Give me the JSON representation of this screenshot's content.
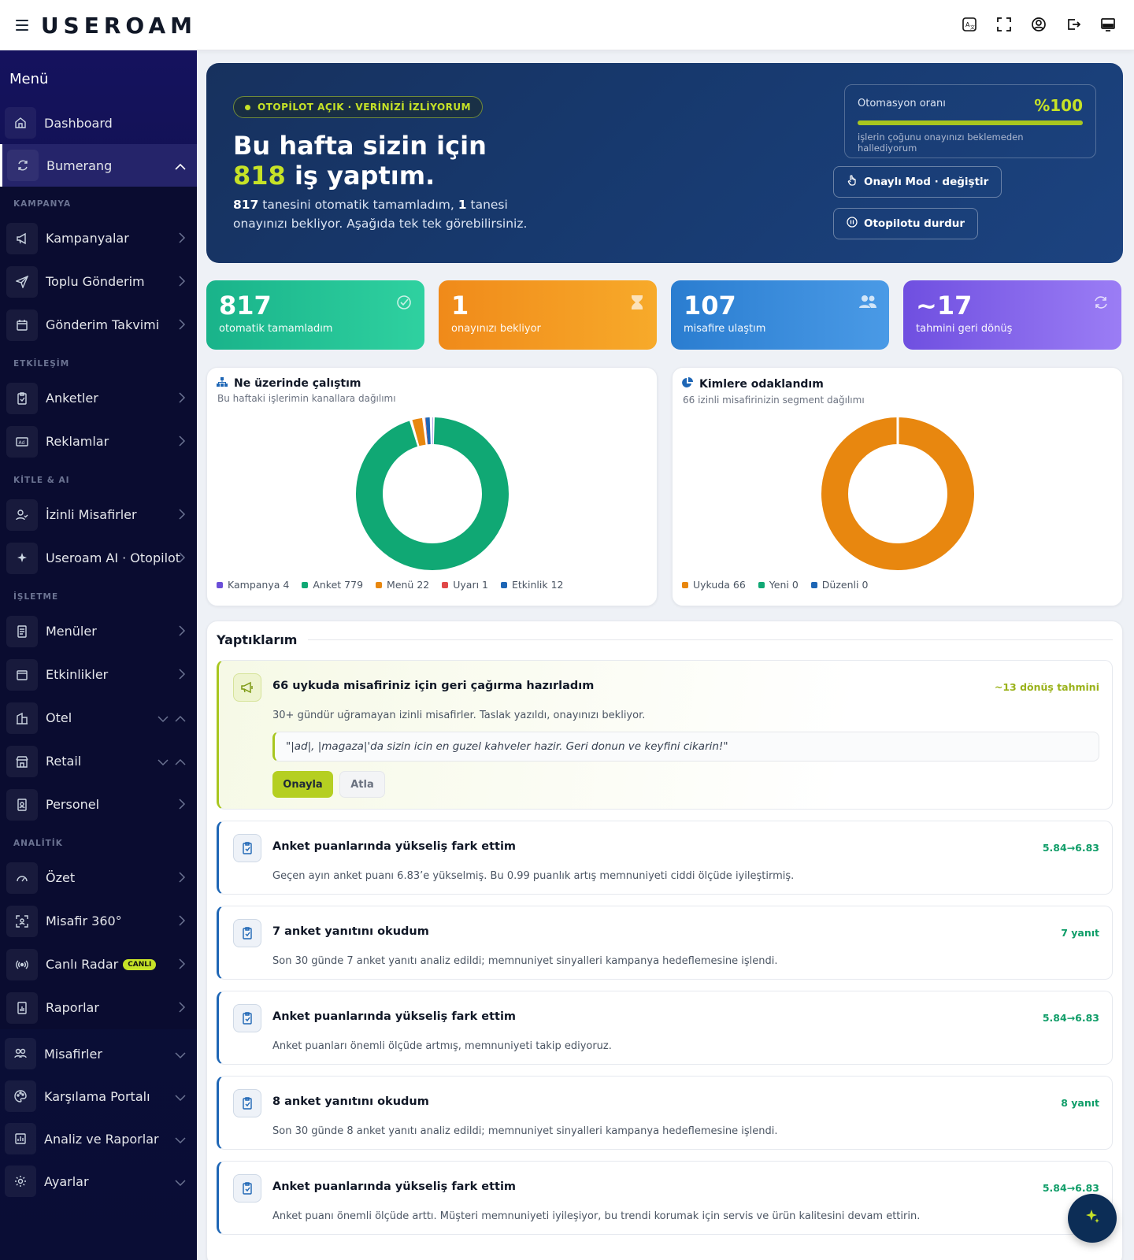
{
  "brand": {
    "logo": "USEROAM"
  },
  "sidebar": {
    "title": "Menü",
    "dashboard": "Dashboard",
    "bumerang": "Bumerang",
    "sections": {
      "kampanya": "KAMPANYA",
      "etkilesim": "ETKİLEŞİM",
      "kitle": "KİTLE & AI",
      "isletme": "İŞLETME",
      "analitik": "ANALİTİK"
    },
    "items": {
      "kampanyalar": "Kampanyalar",
      "toplu": "Toplu Gönderim",
      "takvim": "Gönderim Takvimi",
      "anketler": "Anketler",
      "reklamlar": "Reklamlar",
      "izinli": "İzinli Misafirler",
      "ai": "Useroam AI · Otopilot",
      "menuler": "Menüler",
      "etkinlikler": "Etkinlikler",
      "otel": "Otel",
      "retail": "Retail",
      "personel": "Personel",
      "ozet": "Özet",
      "misafir360": "Misafir 360°",
      "radar": "Canlı Radar",
      "radar_badge": "CANLI",
      "raporlar": "Raporlar"
    },
    "bottom": {
      "misafirler": "Misafirler",
      "portal": "Karşılama Portalı",
      "analiz": "Analiz ve Raporlar",
      "ayarlar": "Ayarlar"
    }
  },
  "hero": {
    "pill": "OTOPİLOT AÇIK · VERİNİZİ İZLİYORUM",
    "title_line1": "Bu hafta sizin için",
    "title_num": "818",
    "title_rest": " iş yaptım.",
    "sub_num1": "817",
    "sub_text1": " tanesini otomatik tamamladım, ",
    "sub_num2": "1",
    "sub_text2": " tanesi onayınızı bekliyor. Aşağıda tek tek görebilirsiniz.",
    "auto_label": "Otomasyon oranı",
    "auto_value": "%100",
    "auto_progress": 100,
    "auto_note": "işlerin çoğunu onayınızı beklemeden hallediyorum",
    "btn_mode": "Onaylı Mod · değiştir",
    "btn_stop": "Otopilotu durdur"
  },
  "stats": [
    {
      "value": "817",
      "label": "otomatik tamamladım",
      "color": "#19b38a"
    },
    {
      "value": "1",
      "label": "onayınızı bekliyor",
      "color": "#f39a1f"
    },
    {
      "value": "107",
      "label": "misafire ulaştım",
      "color": "#2f87d6"
    },
    {
      "value": "~17",
      "label": "tahmini geri dönüş",
      "color": "#7b5ae6"
    }
  ],
  "charts": {
    "channels": {
      "title": "Ne üzerinde çalıştım",
      "subtitle": "Bu haftaki işlerimin kanallara dağılımı",
      "legend": [
        "Kampanya 4",
        "Anket 779",
        "Menü 22",
        "Uyarı 1",
        "Etkinlik 12"
      ]
    },
    "segments": {
      "title": "Kimlere odaklandım",
      "subtitle": "66 izinli misafirinizin segment dağılımı",
      "legend": [
        "Uykuda 66",
        "Yeni 0",
        "Düzenli 0"
      ]
    }
  },
  "chart_data": [
    {
      "type": "pie",
      "categories": [
        "Kampanya",
        "Anket",
        "Menü",
        "Uyarı",
        "Etkinlik"
      ],
      "values": [
        4,
        779,
        22,
        1,
        12
      ],
      "colors": [
        "#6b4fd8",
        "#10a874",
        "#e8870f",
        "#e04848",
        "#1e66b5"
      ],
      "title": "Ne üzerinde çalıştım"
    },
    {
      "type": "pie",
      "categories": [
        "Uykuda",
        "Yeni",
        "Düzenli"
      ],
      "values": [
        66,
        0,
        0
      ],
      "colors": [
        "#e8870f",
        "#10a874",
        "#1e66b5"
      ],
      "title": "Kimlere odaklandım"
    }
  ],
  "activities": {
    "title": "Yaptıklarım",
    "featured": {
      "title": "66 uykuda misafiriniz için geri çağırma hazırladım",
      "meta": "~13 dönüş tahmini",
      "desc": "30+ gündür uğramayan izinli misafirler. Taslak yazıldı, onayınızı bekliyor.",
      "quote": "\"|ad|, |magaza|'da sizin icin en guzel kahveler hazir. Geri donun ve keyfini cikarin!\"",
      "approve": "Onayla",
      "skip": "Atla"
    },
    "items": [
      {
        "title": "Anket puanlarında yükseliş fark ettim",
        "meta": "5.84→6.83",
        "desc": "Geçen ayın anket puanı 6.83’e yükselmiş. Bu 0.99 puanlık artış memnuniyeti ciddi ölçüde iyileştirmiş."
      },
      {
        "title": "7 anket yanıtını okudum",
        "meta": "7 yanıt",
        "desc": "Son 30 günde 7 anket yanıtı analiz edildi; memnuniyet sinyalleri kampanya hedeflemesine işlendi."
      },
      {
        "title": "Anket puanlarında yükseliş fark ettim",
        "meta": "5.84→6.83",
        "desc": "Anket puanları önemli ölçüde artmış, memnuniyeti takip ediyoruz."
      },
      {
        "title": "8 anket yanıtını okudum",
        "meta": "8 yanıt",
        "desc": "Son 30 günde 8 anket yanıtı analiz edildi; memnuniyet sinyalleri kampanya hedeflemesine işlendi."
      },
      {
        "title": "Anket puanlarında yükseliş fark ettim",
        "meta": "5.84→6.83",
        "desc": "Anket puanı önemli ölçüde arttı. Müşteri memnuniyeti iyileşiyor, bu trendi korumak için servis ve ürün kalitesini devam ettirin."
      }
    ]
  }
}
